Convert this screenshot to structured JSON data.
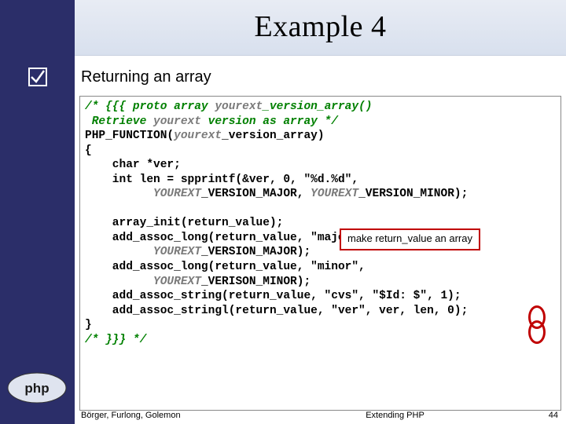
{
  "title": "Example 4",
  "subtitle": "Returning an array",
  "checkmark": {
    "name": "checkmark-box-icon"
  },
  "code": {
    "c1a": "/* {{{ proto array ",
    "c1b": "yourext",
    "c1c": "_version_array()",
    "c2a": " Retrieve ",
    "c2b": "yourext",
    "c2c": " version as array */",
    "l3a": "PHP_FUNCTION(",
    "l3b": "yourext",
    "l3c": "_version_array)",
    "l4": "{",
    "l5": "    char *ver;",
    "l6": "    int len = spprintf(&ver, 0, \"%d.%d\",",
    "l7a": "          ",
    "l7b": "YOUREXT",
    "l7c": "_VERSION_MAJOR, ",
    "l7d": "YOUREXT",
    "l7e": "_VERSION_MINOR);",
    "blank": "",
    "l8": "    array_init(return_value);",
    "l9": "    add_assoc_long(return_value, \"major\",",
    "l10a": "          ",
    "l10b": "YOUREXT",
    "l10c": "_VERSION_MAJOR);",
    "l11": "    add_assoc_long(return_value, \"minor\",",
    "l12a": "          ",
    "l12b": "YOUREXT",
    "l12c": "_VERISON_MINOR);",
    "l13": "    add_assoc_string(return_value, \"cvs\", \"$Id: $\", 1);",
    "l14": "    add_assoc_stringl(return_value, \"ver\", ver, len, 0);",
    "l15": "}",
    "c16": "/* }}} */"
  },
  "annotation": "make return_value an array",
  "footer": {
    "authors": "Börger, Furlong, Golemon",
    "center": "Extending PHP",
    "page": "44"
  }
}
